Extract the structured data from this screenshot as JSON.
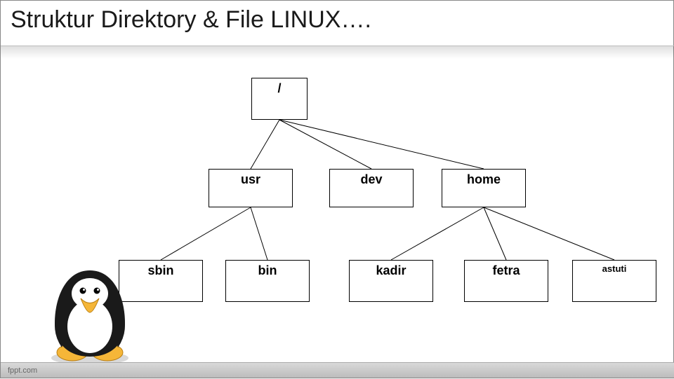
{
  "title": "Struktur Direktory & File LINUX….",
  "footer": "fppt.com",
  "nodes": {
    "root": "/",
    "usr": "usr",
    "dev": "dev",
    "home": "home",
    "sbin": "sbin",
    "bin": "bin",
    "kadir": "kadir",
    "fetra": "fetra",
    "astuti": "astuti"
  },
  "chart_data": {
    "type": "tree",
    "title": "Struktur Direktory & File LINUX",
    "root": {
      "label": "/",
      "children": [
        {
          "label": "usr",
          "children": [
            {
              "label": "sbin"
            },
            {
              "label": "bin"
            }
          ]
        },
        {
          "label": "dev"
        },
        {
          "label": "home",
          "children": [
            {
              "label": "kadir"
            },
            {
              "label": "fetra"
            },
            {
              "label": "astuti"
            }
          ]
        }
      ]
    }
  }
}
